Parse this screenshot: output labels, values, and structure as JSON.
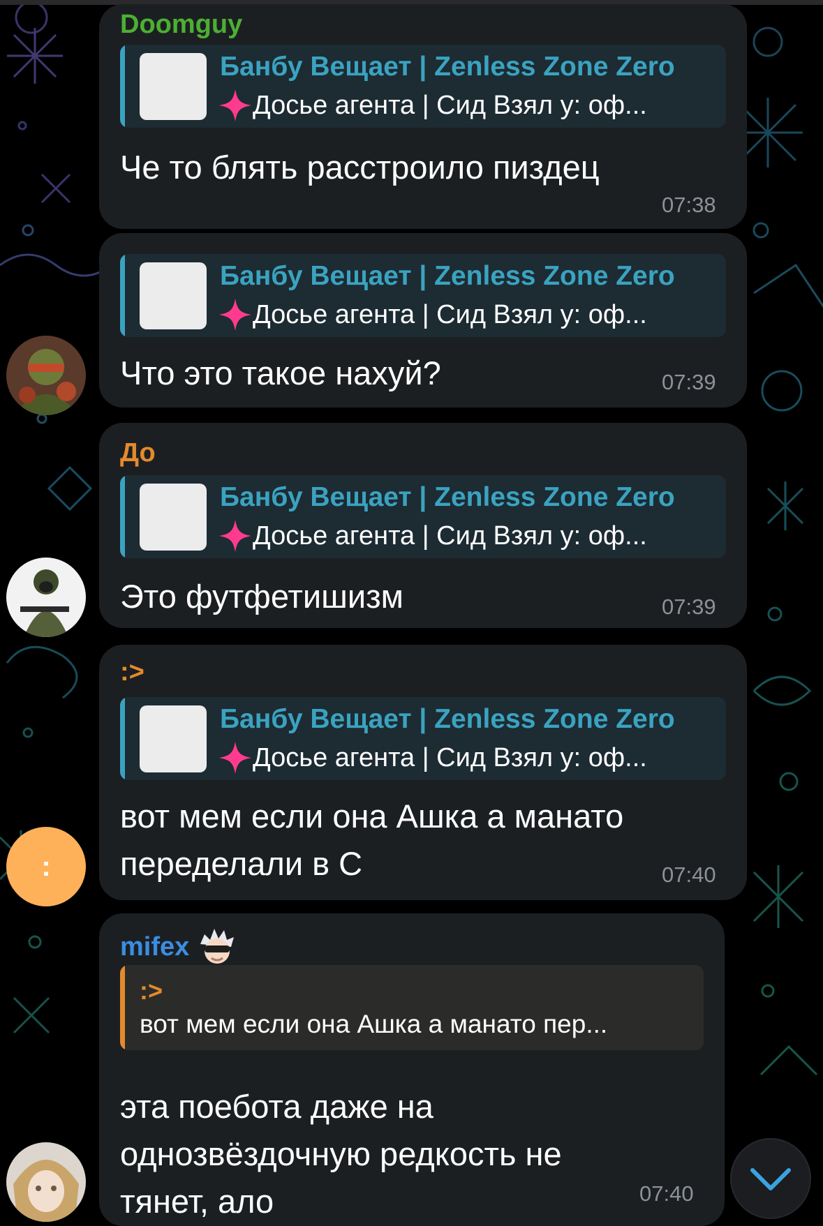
{
  "messages": [
    {
      "sender": "Doomguy",
      "sender_color": "#4caf33",
      "reply_title": "Банбу Вещает | Zenless Zone Zero",
      "reply_sub": "Досье агента | Сид Взял у: оф...",
      "text": "Че то блять расстроило пиздец",
      "time": "07:38"
    },
    {
      "reply_title": "Банбу Вещает | Zenless Zone Zero",
      "reply_sub": "Досье агента | Сид Взял у: оф...",
      "text": "Что это такое нахуй?",
      "time": "07:39"
    },
    {
      "sender": "До",
      "sender_color": "#e38a2c",
      "reply_title": "Банбу Вещает | Zenless Zone Zero",
      "reply_sub": "Досье агента | Сид Взял у: оф...",
      "text": "Это футфетишизм",
      "time": "07:39"
    },
    {
      "sender": ":>",
      "sender_color": "#e38a2c",
      "reply_title": "Банбу Вещает | Zenless Zone Zero",
      "reply_sub": "Досье агента | Сид Взял у: оф...",
      "text": "вот мем если она Ашка а манато\nпеределали в С",
      "time": "07:40"
    },
    {
      "sender": "mifex",
      "sender_color": "#3b8de0",
      "reply_name": ":>",
      "reply_text": "вот мем если она Ашка а манато пер...",
      "text": "эта поебота даже на\nоднозвёздочную редкость не\nтянет, ало",
      "time": "07:40"
    }
  ],
  "avatars": {
    "colon_avatar_label": ":",
    "colon_avatar_color": "#ffb15a"
  },
  "icons": {
    "reply_prefix": "pink-sparkle-icon",
    "scroll_down": "chevron-down-icon"
  },
  "colors": {
    "reply_accent": "#3aa3c0",
    "bubble_bg": "#1c1f22",
    "timestamp": "#8d9298"
  }
}
